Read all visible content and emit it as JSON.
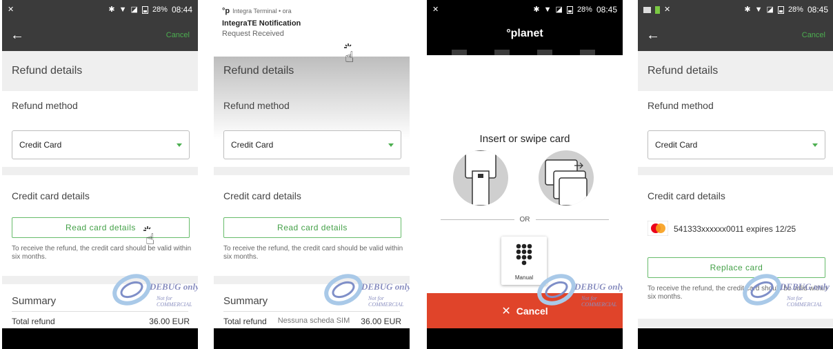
{
  "status": {
    "time_1": "08:44",
    "time_2": "08:45",
    "battery": "28%"
  },
  "appbar": {
    "back_icon": "arrow-left-icon",
    "cancel_label": "Cancel"
  },
  "refund": {
    "title": "Refund details",
    "method_label": "Refund method",
    "method_value": "Credit Card",
    "card_section_title": "Credit card details",
    "read_card_button": "Read card details",
    "note": "To receive the refund, the credit card should be valid within six months.",
    "summary_title": "Summary",
    "total_label": "Total refund",
    "total_value": "36.00 EUR"
  },
  "notification": {
    "app_name": "Integra Terminal • ora",
    "title": "IntegraTE Notification",
    "subtitle": "Request Received",
    "sim_text": "Nessuna scheda SIM"
  },
  "payment": {
    "brand": "°planet",
    "instruction": "Insert or swipe card",
    "or_label": "OR",
    "manual_label": "Manual",
    "cancel_label": "Cancel"
  },
  "card_result": {
    "card_text": "541333xxxxxx0011 expires 12/25",
    "replace_button": "Replace card"
  },
  "watermark": {
    "main": "DEBUG only",
    "sub": "Not for COMMERCIAL"
  },
  "colors": {
    "accent_green": "#4caf50",
    "cancel_red": "#e0442a",
    "bar_dark": "#3b3b3b"
  }
}
